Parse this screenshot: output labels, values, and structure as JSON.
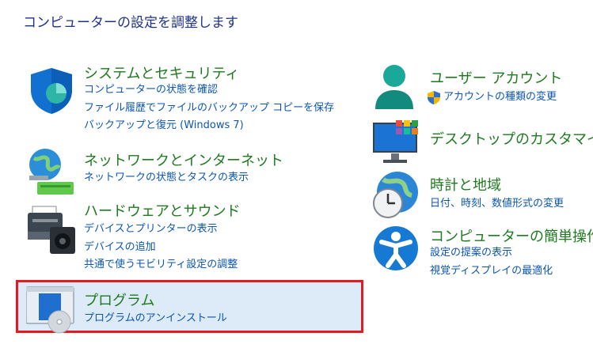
{
  "header": {
    "title": "コンピューターの設定を調整します"
  },
  "categories": [
    {
      "title": "システムとセキュリティ",
      "icon": "security-shield-icon",
      "links": [
        "コンピューターの状態を確認",
        "ファイル履歴でファイルのバックアップ コピーを保存",
        "バックアップと復元 (Windows 7)"
      ]
    },
    {
      "title": "ネットワークとインターネット",
      "icon": "network-globe-icon",
      "links": [
        "ネットワークの状態とタスクの表示"
      ]
    },
    {
      "title": "ハードウェアとサウンド",
      "icon": "printer-speaker-icon",
      "links": [
        "デバイスとプリンターの表示",
        "デバイスの追加",
        "共通で使うモビリティ設定の調整"
      ]
    },
    {
      "title": "プログラム",
      "icon": "programs-disc-icon",
      "selected": true,
      "links": [
        "プログラムのアンインストール"
      ]
    },
    {
      "title": "ユーザー アカウント",
      "icon": "user-account-icon",
      "links": [
        "アカウントの種類の変更"
      ]
    },
    {
      "title": "デスクトップのカスタマイズ",
      "icon": "desktop-monitor-icon",
      "links": []
    },
    {
      "title": "時計と地域",
      "icon": "clock-globe-icon",
      "links": [
        "日付、時刻、数値形式の変更"
      ]
    },
    {
      "title": "コンピューターの簡単操作",
      "icon": "accessibility-icon",
      "links": [
        "設定の提案の表示",
        "視覚ディスプレイの最適化"
      ]
    }
  ],
  "colors": {
    "title_link": "#1e7a1e",
    "link": "#0b56b4",
    "header": "#1e3287",
    "highlight_border": "#e01b24"
  }
}
